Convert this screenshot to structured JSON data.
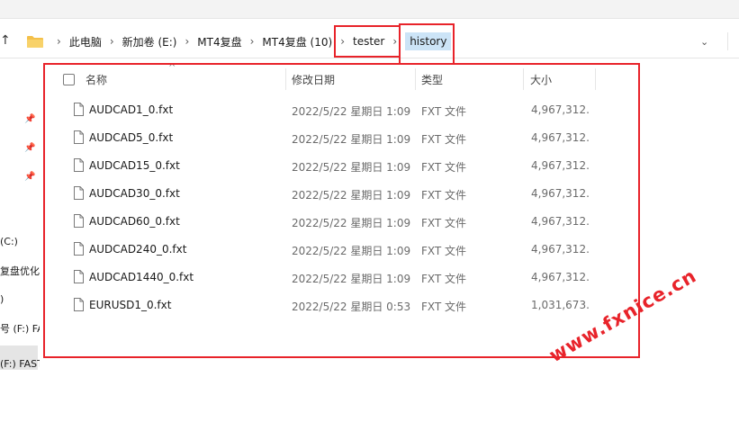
{
  "breadcrumbs": [
    "此电脑",
    "新加卷 (E:)",
    "MT4复盘",
    "MT4复盘 (10)",
    "tester",
    "history"
  ],
  "columns": {
    "name": "名称",
    "modified": "修改日期",
    "type": "类型",
    "size": "大小"
  },
  "files": [
    {
      "name": "AUDCAD1_0.fxt",
      "modified": "2022/5/22 星期日 1:09",
      "type": "FXT 文件",
      "size": "4,967,312..."
    },
    {
      "name": "AUDCAD5_0.fxt",
      "modified": "2022/5/22 星期日 1:09",
      "type": "FXT 文件",
      "size": "4,967,312..."
    },
    {
      "name": "AUDCAD15_0.fxt",
      "modified": "2022/5/22 星期日 1:09",
      "type": "FXT 文件",
      "size": "4,967,312..."
    },
    {
      "name": "AUDCAD30_0.fxt",
      "modified": "2022/5/22 星期日 1:09",
      "type": "FXT 文件",
      "size": "4,967,312..."
    },
    {
      "name": "AUDCAD60_0.fxt",
      "modified": "2022/5/22 星期日 1:09",
      "type": "FXT 文件",
      "size": "4,967,312..."
    },
    {
      "name": "AUDCAD240_0.fxt",
      "modified": "2022/5/22 星期日 1:09",
      "type": "FXT 文件",
      "size": "4,967,312..."
    },
    {
      "name": "AUDCAD1440_0.fxt",
      "modified": "2022/5/22 星期日 1:09",
      "type": "FXT 文件",
      "size": "4,967,312..."
    },
    {
      "name": "EURUSD1_0.fxt",
      "modified": "2022/5/22 星期日 0:53",
      "type": "FXT 文件",
      "size": "1,031,673..."
    }
  ],
  "sidebar": {
    "items": [
      "(C:)",
      "复盘优化",
      ")",
      "号 (F:) FA",
      "(F:) FAST"
    ]
  },
  "watermark": "www.fxnice.cn",
  "colors": {
    "annotation_red": "#e8232a",
    "selection_blue": "#cce4f7",
    "folder_yellow": "#f4c04a"
  }
}
